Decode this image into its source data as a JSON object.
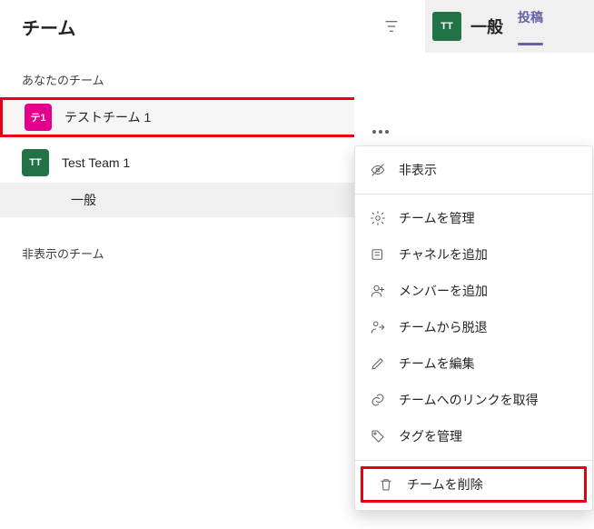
{
  "header": {
    "title": "チーム",
    "channel": {
      "avatar": "TT",
      "name": "一般",
      "tab_posts": "投稿"
    }
  },
  "sections": {
    "your_teams": "あなたのチーム",
    "hidden_teams": "非表示のチーム"
  },
  "teams": [
    {
      "avatar": "テ1",
      "name": "テストチーム 1"
    },
    {
      "avatar": "TT",
      "name": "Test Team 1",
      "channel": "一般"
    }
  ],
  "menu": {
    "hide": "非表示",
    "manage_team": "チームを管理",
    "add_channel": "チャネルを追加",
    "add_member": "メンバーを追加",
    "leave_team": "チームから脱退",
    "edit_team": "チームを編集",
    "get_link": "チームへのリンクを取得",
    "manage_tags": "タグを管理",
    "delete_team": "チームを削除"
  }
}
